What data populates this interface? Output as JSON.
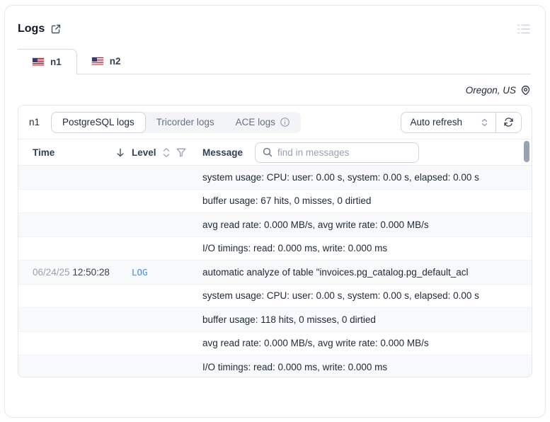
{
  "header": {
    "title": "Logs"
  },
  "icons": {
    "title_action": "external-link-icon",
    "top_right": "list-lines-icon",
    "region": "map-pin-icon",
    "segment_info": "info-circle-icon",
    "select": "chevron-up-down-icon",
    "refresh": "refresh-arrows-icon",
    "time_sort": "arrow-down-icon",
    "level_sort": "arrows-up-down-icon",
    "level_filter": "funnel-icon",
    "search": "magnifier-icon",
    "tab_flag": "us-flag-icon"
  },
  "tabs": [
    {
      "label": "n1",
      "active": true
    },
    {
      "label": "n2",
      "active": false
    }
  ],
  "region": {
    "label": "Oregon, US"
  },
  "toolbar": {
    "node_label": "n1",
    "segments": [
      {
        "label": "PostgreSQL logs",
        "active": true
      },
      {
        "label": "Tricorder logs",
        "active": false
      },
      {
        "label": "ACE logs",
        "active": false,
        "has_info": true
      }
    ],
    "refresh_select": "Auto refresh"
  },
  "table": {
    "columns": {
      "time": "Time",
      "level": "Level",
      "message": "Message"
    },
    "search_placeholder": "find in messages",
    "rows": [
      {
        "date": "",
        "time": "",
        "level": "",
        "message": "system usage: CPU: user: 0.00 s, system: 0.00 s, elapsed: 0.00 s"
      },
      {
        "date": "",
        "time": "",
        "level": "",
        "message": "buffer usage: 67 hits, 0 misses, 0 dirtied"
      },
      {
        "date": "",
        "time": "",
        "level": "",
        "message": "avg read rate: 0.000 MB/s, avg write rate: 0.000 MB/s"
      },
      {
        "date": "",
        "time": "",
        "level": "",
        "message": "I/O timings: read: 0.000 ms, write: 0.000 ms"
      },
      {
        "date": "06/24/25",
        "time": "12:50:28",
        "level": "LOG",
        "message": "automatic analyze of table \"invoices.pg_catalog.pg_default_acl"
      },
      {
        "date": "",
        "time": "",
        "level": "",
        "message": "system usage: CPU: user: 0.00 s, system: 0.00 s, elapsed: 0.00 s"
      },
      {
        "date": "",
        "time": "",
        "level": "",
        "message": "buffer usage: 118 hits, 0 misses, 0 dirtied"
      },
      {
        "date": "",
        "time": "",
        "level": "",
        "message": "avg read rate: 0.000 MB/s, avg write rate: 0.000 MB/s"
      },
      {
        "date": "",
        "time": "",
        "level": "",
        "message": "I/O timings: read: 0.000 ms, write: 0.000 ms"
      }
    ]
  },
  "colors": {
    "accent_blue": "#3d8df5",
    "border": "#e4e7ec",
    "muted_text": "#667085",
    "placeholder": "#98a2b3",
    "stripe_bg": "#f8f9fb"
  }
}
